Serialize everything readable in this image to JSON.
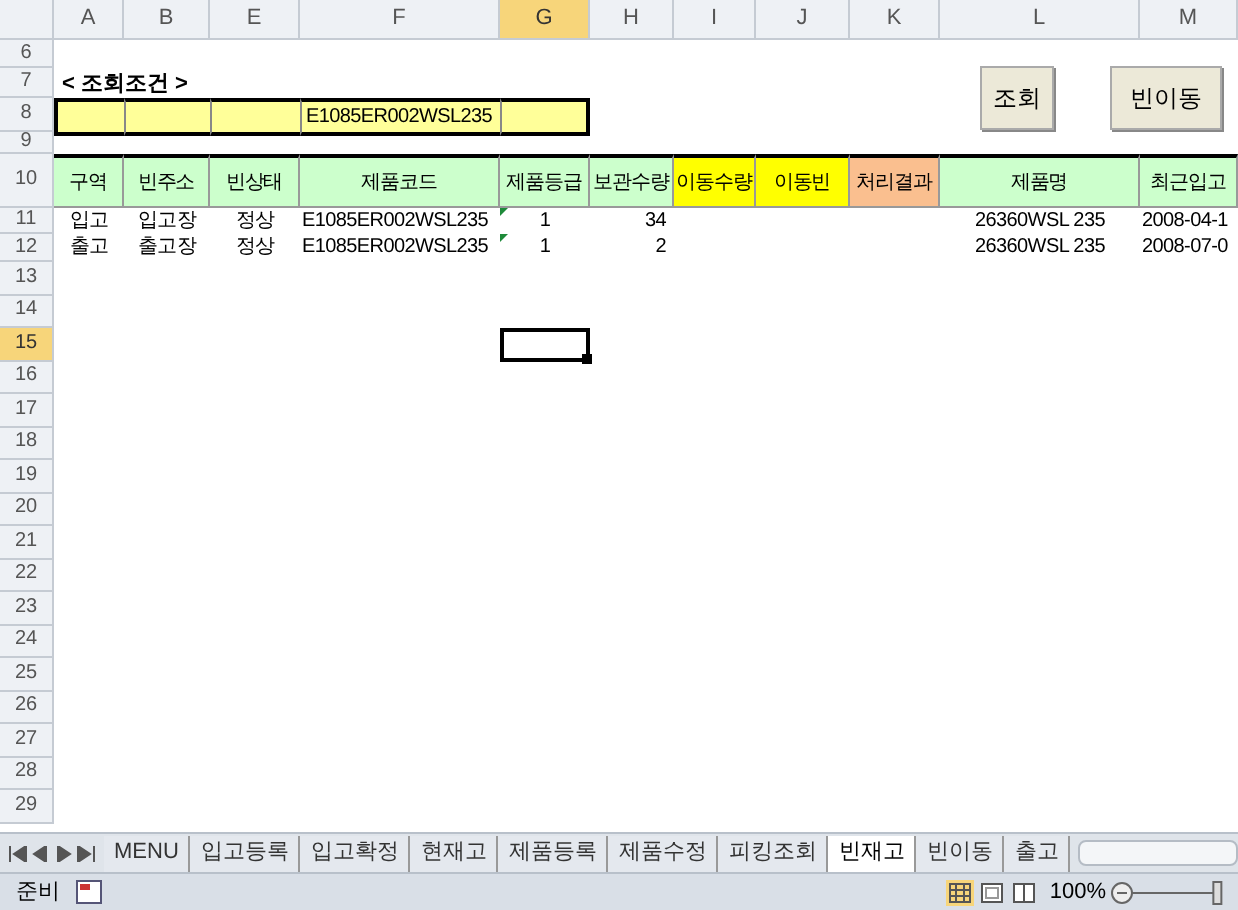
{
  "column_headers": [
    {
      "label": "A",
      "selected": false
    },
    {
      "label": "B",
      "selected": false
    },
    {
      "label": "E",
      "selected": false
    },
    {
      "label": "F",
      "selected": false
    },
    {
      "label": "G",
      "selected": true
    },
    {
      "label": "H",
      "selected": false
    },
    {
      "label": "I",
      "selected": false
    },
    {
      "label": "J",
      "selected": false
    },
    {
      "label": "K",
      "selected": false
    },
    {
      "label": "L",
      "selected": false
    },
    {
      "label": "M",
      "selected": false
    }
  ],
  "row_headers": [
    {
      "label": "6",
      "selected": false
    },
    {
      "label": "7",
      "selected": false
    },
    {
      "label": "8",
      "selected": false
    },
    {
      "label": "9",
      "selected": false
    },
    {
      "label": "10",
      "selected": false
    },
    {
      "label": "11",
      "selected": false
    },
    {
      "label": "12",
      "selected": false
    },
    {
      "label": "13",
      "selected": false
    },
    {
      "label": "14",
      "selected": false
    },
    {
      "label": "15",
      "selected": true
    },
    {
      "label": "16",
      "selected": false
    },
    {
      "label": "17",
      "selected": false
    },
    {
      "label": "18",
      "selected": false
    },
    {
      "label": "19",
      "selected": false
    },
    {
      "label": "20",
      "selected": false
    },
    {
      "label": "21",
      "selected": false
    },
    {
      "label": "22",
      "selected": false
    },
    {
      "label": "23",
      "selected": false
    },
    {
      "label": "24",
      "selected": false
    },
    {
      "label": "25",
      "selected": false
    },
    {
      "label": "26",
      "selected": false
    },
    {
      "label": "27",
      "selected": false
    },
    {
      "label": "28",
      "selected": false
    },
    {
      "label": "29",
      "selected": false
    }
  ],
  "query": {
    "title": "< 조회조건 >",
    "product_code": "E1085ER002WSL235"
  },
  "buttons": [
    "조회",
    "빈이동"
  ],
  "table": {
    "columns": [
      {
        "label": "구역",
        "kind": "text",
        "color": "#ccffcc"
      },
      {
        "label": "빈주소",
        "kind": "text",
        "color": "#ccffcc"
      },
      {
        "label": "빈상태",
        "kind": "text",
        "color": "#ccffcc"
      },
      {
        "label": "제품코드",
        "kind": "code",
        "color": "#ccffcc"
      },
      {
        "label": "제품등급",
        "kind": "flagged",
        "color": "#ccffcc"
      },
      {
        "label": "보관수량",
        "kind": "number",
        "color": "#ccffcc"
      },
      {
        "label": "이동수량",
        "kind": "number",
        "color": "#ffff00"
      },
      {
        "label": "이동빈",
        "kind": "text",
        "color": "#ffff00"
      },
      {
        "label": "처리결과",
        "kind": "text",
        "color": "#fabf8f"
      },
      {
        "label": "제품명",
        "kind": "text",
        "color": "#ccffcc"
      },
      {
        "label": "최근입고",
        "kind": "code",
        "color": "#ccffcc"
      }
    ],
    "rows": [
      {
        "cells": [
          "입고",
          "입고장",
          "정상",
          "E1085ER002WSL235",
          "1",
          "34",
          null,
          null,
          null,
          "26360WSL 235",
          "2008-04-1"
        ],
        "warning": true
      },
      {
        "cells": [
          "출고",
          "출고장",
          "정상",
          "E1085ER002WSL235",
          "1",
          "2",
          null,
          null,
          null,
          "26360WSL 235",
          "2008-07-0"
        ],
        "warning": true
      }
    ]
  },
  "sheet_tabs": [
    {
      "label": "MENU",
      "selected": false
    },
    {
      "label": "입고등록",
      "selected": false
    },
    {
      "label": "입고확정",
      "selected": false
    },
    {
      "label": "현재고",
      "selected": false
    },
    {
      "label": "제품등록",
      "selected": false
    },
    {
      "label": "제품수정",
      "selected": false
    },
    {
      "label": "피킹조회",
      "selected": false
    },
    {
      "label": "빈재고",
      "selected": true
    },
    {
      "label": "빈이동",
      "selected": false
    },
    {
      "label": "출고",
      "selected": false
    }
  ],
  "status_bar": {
    "text": "준비",
    "zoom": "100%",
    "zoom_slider": {
      "level": 0.97
    }
  }
}
